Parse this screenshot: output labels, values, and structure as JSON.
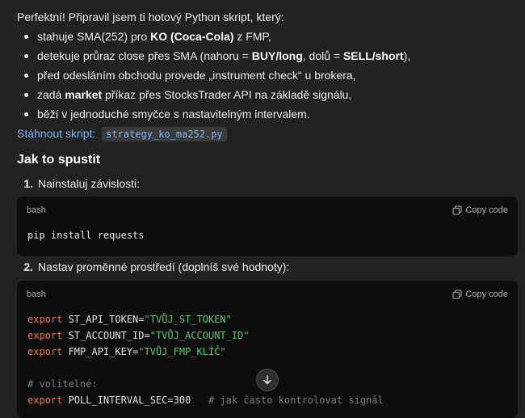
{
  "intro": "Perfektní! Připravil jsem ti hotový Python skript, který:",
  "bullets": [
    {
      "parts": [
        "stahuje SMA(252) pro ",
        "KO (Coca-Cola)",
        " z FMP,"
      ]
    },
    {
      "parts": [
        "detekuje průraz close přes SMA (nahoru = ",
        "BUY/long",
        ", dolů = ",
        "SELL/short",
        "),"
      ]
    },
    {
      "parts": [
        "před odesláním obchodu provede „instrument check“ u brokera,"
      ]
    },
    {
      "parts": [
        "zadá ",
        "market",
        " příkaz přes StocksTrader API na základě signálu,"
      ]
    },
    {
      "parts": [
        "běží v jednoduché smyčce s nastavitelným intervalem."
      ]
    }
  ],
  "download": {
    "label": "Stáhnout skript:",
    "filename": "strategy_ko_ma252.py"
  },
  "section_title": "Jak to spustit",
  "steps": [
    {
      "num": "1.",
      "text": "Nainstaluj závislosti:"
    },
    {
      "num": "2.",
      "text": "Nastav proměnné prostředí (doplníš své hodnoty):"
    }
  ],
  "code_blocks": [
    {
      "lang": "bash",
      "copy_label": "Copy code",
      "lines": [
        "pip install requests"
      ]
    },
    {
      "lang": "bash",
      "copy_label": "Copy code",
      "env": [
        {
          "kw": "export",
          "name": " ST_API_TOKEN=",
          "value": "\"TVŮJ_ST_TOKEN\""
        },
        {
          "kw": "export",
          "name": " ST_ACCOUNT_ID=",
          "value": "\"TVŮJ_ACCOUNT_ID\""
        },
        {
          "kw": "export",
          "name": " FMP_API_KEY=",
          "value": "\"TVŮJ_FMP_KLÍČ\""
        }
      ],
      "comment": "# volitelné:",
      "last": {
        "kw": "export",
        "name": " POLL_INTERVAL_SEC=300",
        "comment": "   # jak často kontrolovat signál"
      }
    }
  ],
  "icons": {
    "copy": "copy-icon",
    "scroll": "arrow-down-icon"
  }
}
